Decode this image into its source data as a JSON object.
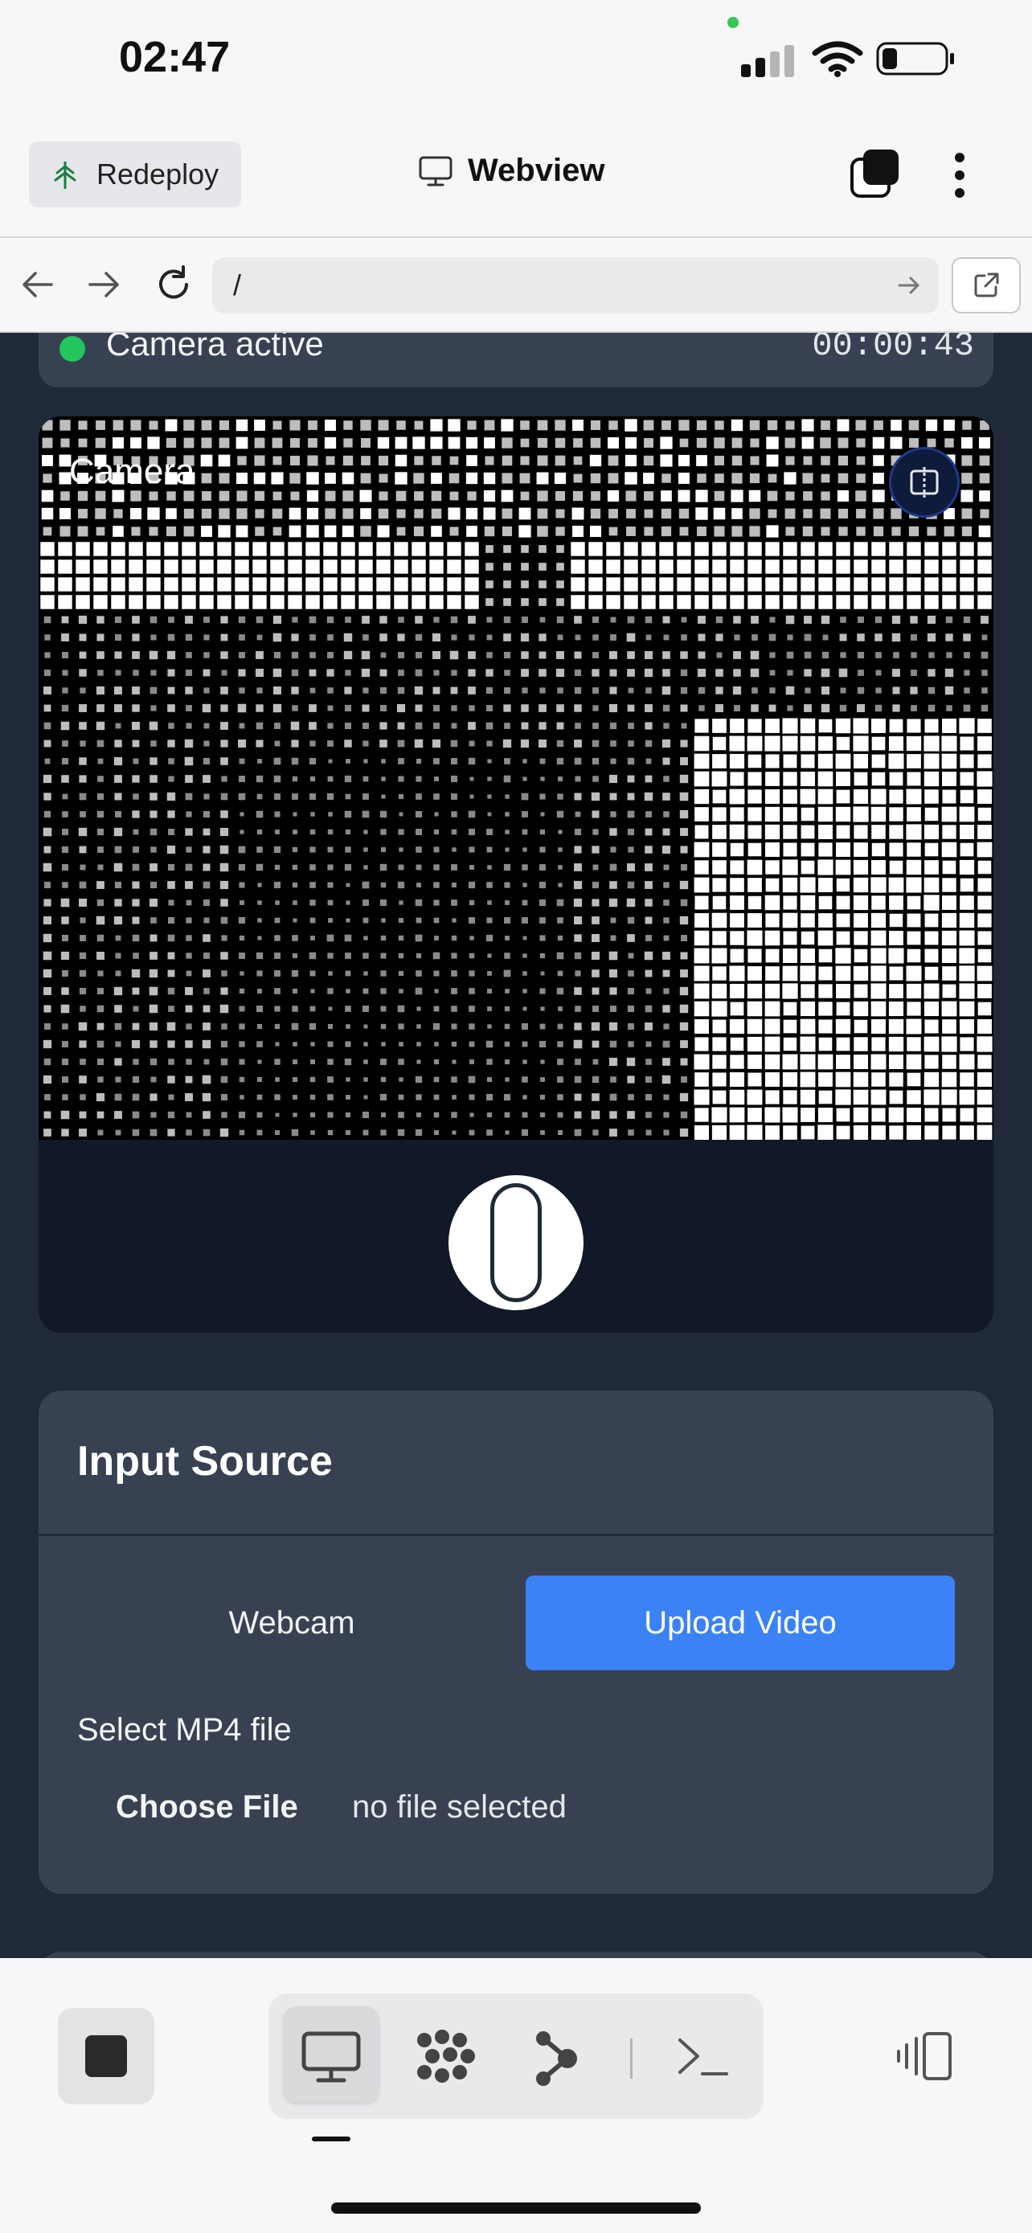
{
  "statusbar": {
    "time": "02:47"
  },
  "header": {
    "redeploy_label": "Redeploy",
    "title": "Webview"
  },
  "browser": {
    "url": "/"
  },
  "camera_status": {
    "text": "Camera active",
    "timer": "00:00:43"
  },
  "camera": {
    "label": "Camera"
  },
  "input_source": {
    "title": "Input Source",
    "tabs": [
      "Webcam",
      "Upload Video"
    ],
    "selected_tab": "Upload Video",
    "file_label": "Select MP4 file",
    "choose_button": "Choose File",
    "file_status": "no file selected"
  },
  "colors": {
    "accent": "#3b82f6",
    "page_bg": "#1f2937",
    "card_bg": "#374151",
    "status_green": "#22c55e"
  },
  "icons": [
    "redeploy-tree-icon",
    "monitor-icon",
    "stack-icon",
    "more-vertical-icon",
    "back-arrow-icon",
    "forward-arrow-icon",
    "reload-icon",
    "go-arrow-icon",
    "external-link-icon",
    "camera-flip-icon",
    "stop-icon",
    "grid-dots-icon",
    "graph-icon",
    "terminal-icon",
    "device-switch-icon"
  ]
}
